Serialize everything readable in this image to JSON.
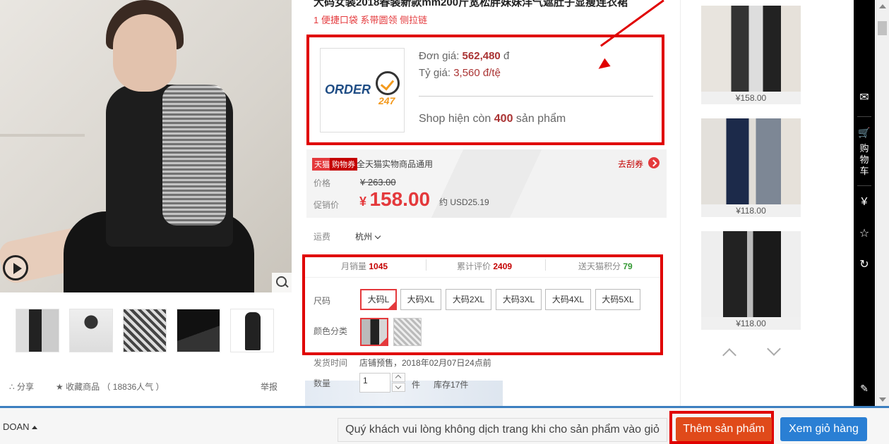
{
  "product": {
    "title": "大码女装2018春装新款mm200斤宽松胖妹妹洋气遮肚子显瘦连衣裙",
    "subtitle": "1 便捷口袋 系带圆领 侧拉链"
  },
  "order_box": {
    "logo_text_order": "ORDER",
    "logo_text_24": "247",
    "unit_price_label": "Đơn giá:",
    "unit_price_value": "562,480",
    "unit_price_currency": "đ",
    "rate_label": "Tỷ giá:",
    "rate_value": "3,560 đ/tệ",
    "stock_prefix": "Shop hiện còn",
    "stock_count": "400",
    "stock_suffix": "sản phẩm"
  },
  "coupon": {
    "tmall_tag": "天猫",
    "gouwu_tag": "购物券",
    "text": "全天猫实物商品通用",
    "link": "去刮券"
  },
  "price": {
    "price_label": "价格",
    "old_price": "¥ 263.00",
    "promo_label": "促销价",
    "promo_currency": "¥",
    "promo_value": "158.00",
    "usd": "约 USD25.19"
  },
  "shipping": {
    "label": "运费",
    "value": "杭州"
  },
  "stats": {
    "monthly_label": "月销量",
    "monthly_value": "1045",
    "reviews_label": "累计评价",
    "reviews_value": "2409",
    "points_label": "送天猫积分",
    "points_value": "79"
  },
  "sku": {
    "size_label": "尺码",
    "sizes": [
      "大码L",
      "大码XL",
      "大码2XL",
      "大码3XL",
      "大码4XL",
      "大码5XL"
    ],
    "color_label": "颜色分类"
  },
  "delivery": {
    "label": "发货时间",
    "value": "店铺预售，2018年02月07日24点前"
  },
  "quantity": {
    "label": "数量",
    "value": "1",
    "unit": "件",
    "stock": "库存17件"
  },
  "social": {
    "share": "分享",
    "favorite": "收藏商品",
    "popularity": "（ 18836人气 ）",
    "report": "举报"
  },
  "right_thumbs": [
    {
      "price": "¥158.00"
    },
    {
      "price": "¥118.00"
    },
    {
      "price": "¥118.00"
    }
  ],
  "sidebar": {
    "cart_label_1": "购",
    "cart_label_2": "物",
    "cart_label_3": "车",
    "icons": [
      "mail-icon",
      "cart-icon",
      "yen-icon",
      "star-icon",
      "history-icon",
      "edit-icon"
    ]
  },
  "bottom": {
    "user": "DOAN",
    "note": "Quý khách vui lòng không dịch trang khi cho sản phẩm vào giỏ",
    "add_button": "Thêm sản phẩm",
    "cart_button": "Xem giỏ hàng"
  },
  "colors": {
    "accent_red": "#e4393c",
    "highlight_red": "#e00000",
    "add_button": "#e04a1a",
    "cart_button": "#2a7fd4"
  }
}
